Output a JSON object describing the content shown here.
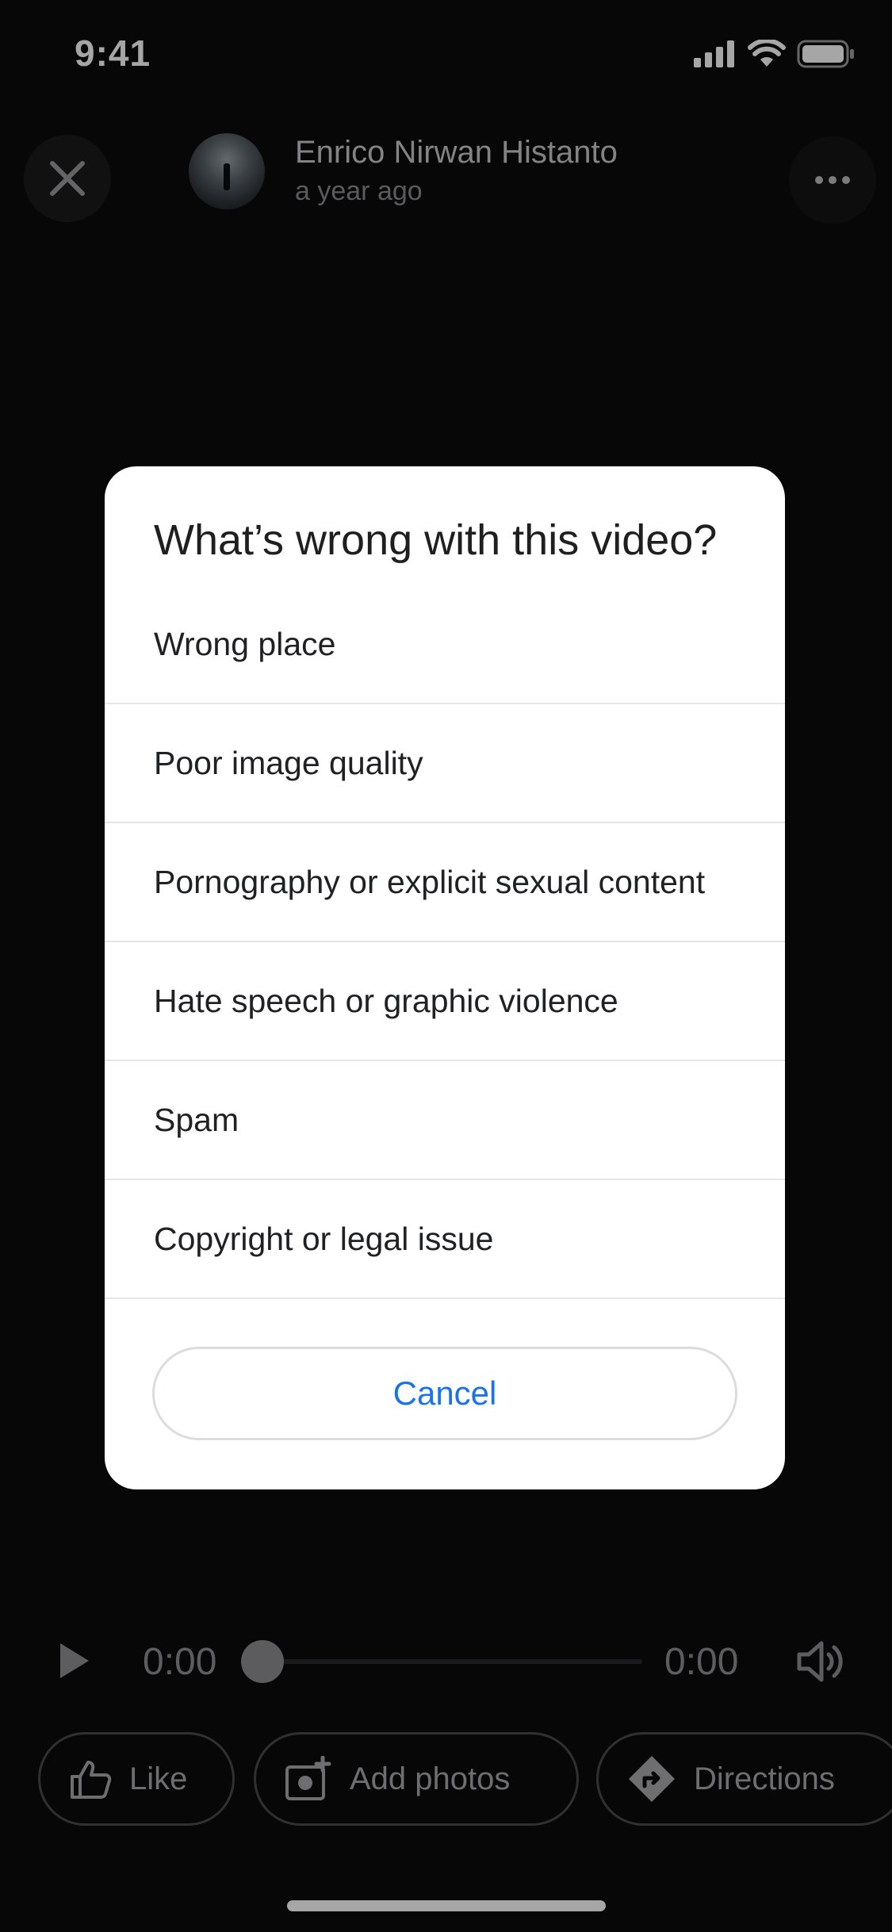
{
  "status_bar": {
    "time": "9:41",
    "icons": [
      "cellular-signal-icon",
      "wifi-icon",
      "battery-icon"
    ]
  },
  "header": {
    "user_name": "Enrico Nirwan Histanto",
    "posted": "a year ago",
    "close_icon": "close-icon",
    "more_icon": "more-options-icon"
  },
  "player": {
    "current_time": "0:00",
    "duration": "0:00",
    "progress": 0
  },
  "actions": {
    "like": "Like",
    "add_photos": "Add photos",
    "directions": "Directions"
  },
  "dialog": {
    "title": "What’s wrong with this video?",
    "options": [
      "Wrong place",
      "Poor image quality",
      "Pornography or explicit sexual content",
      "Hate speech or graphic violence",
      "Spam",
      "Copyright or legal issue"
    ],
    "cancel": "Cancel"
  },
  "colors": {
    "accent": "#1a73e8",
    "background": "#0b0b0c",
    "dialog_bg": "#ffffff"
  }
}
